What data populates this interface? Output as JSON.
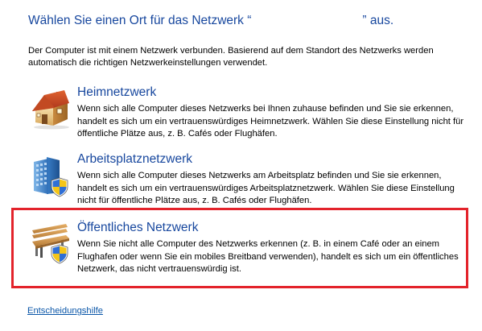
{
  "title": {
    "prefix": "Wählen Sie einen Ort für das Netzwerk “",
    "suffix": "” aus."
  },
  "intro": "Der Computer ist mit einem Netzwerk verbunden. Basierend auf dem Standort des Netzwerks werden automatisch die richtigen Netzwerkeinstellungen verwendet.",
  "options": [
    {
      "title": "Heimnetzwerk",
      "description": "Wenn sich alle Computer dieses Netzwerks bei Ihnen zuhause befinden und Sie sie erkennen, handelt es sich um ein vertrauenswürdiges Heimnetzwerk. Wählen Sie diese Einstellung nicht für öffentliche Plätze aus, z. B. Cafés oder Flughäfen.",
      "icon": "house-icon"
    },
    {
      "title": "Arbeitsplatznetzwerk",
      "description": "Wenn sich alle Computer dieses Netzwerks am Arbeitsplatz befinden und Sie sie erkennen, handelt es sich um ein vertrauenswürdiges Arbeitsplatznetzwerk. Wählen Sie diese Einstellung nicht für öffentliche Plätze aus, z. B. Cafés oder Flughäfen.",
      "icon": "office-building-shield-icon"
    },
    {
      "title": "Öffentliches Netzwerk",
      "description": "Wenn Sie nicht alle Computer des Netzwerks erkennen (z. B. in einem Café oder an einem Flughafen oder wenn Sie ein mobiles Breitband verwenden), handelt es sich um ein öffentliches Netzwerk, das nicht vertrauenswürdig ist.",
      "icon": "park-bench-shield-icon"
    }
  ],
  "help_link": "Entscheidungshilfe",
  "colors": {
    "title": "#17479e",
    "link": "#0a56a8",
    "highlight": "#e3232b"
  }
}
